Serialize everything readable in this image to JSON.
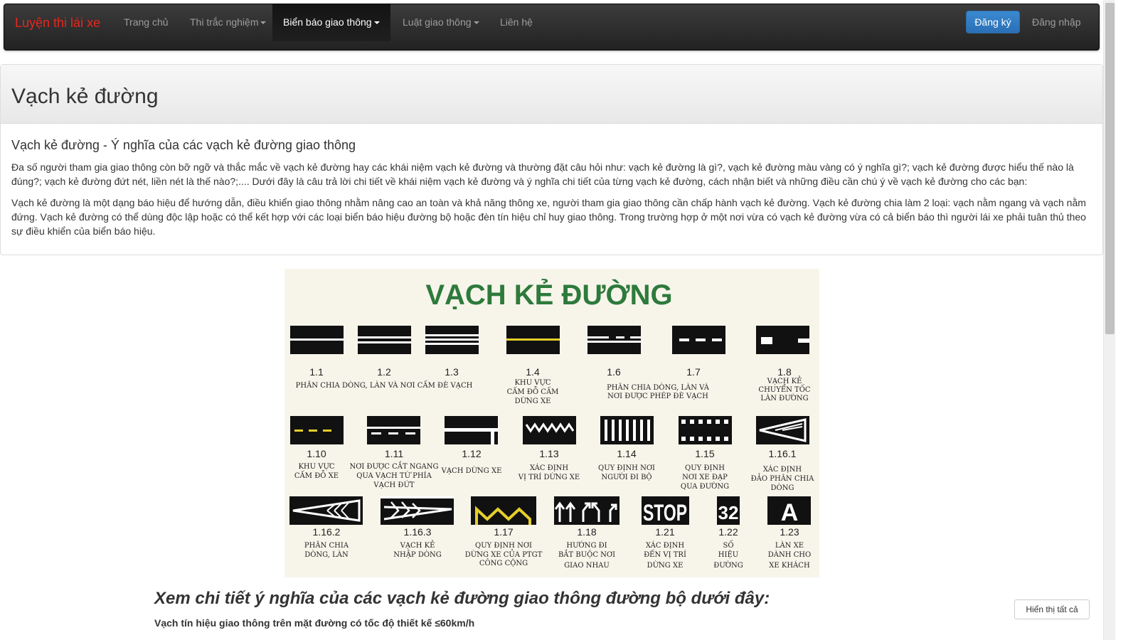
{
  "navbar": {
    "brand": "Luyện thi lái xe",
    "items": [
      {
        "label": "Trang chủ",
        "dropdown": false
      },
      {
        "label": "Thi trắc nghiệm",
        "dropdown": true
      },
      {
        "label": "Biển báo giao thông",
        "dropdown": true,
        "active": true
      },
      {
        "label": "Luật giao thông",
        "dropdown": true
      },
      {
        "label": "Liên hệ",
        "dropdown": false
      }
    ],
    "register_label": "Đăng ký",
    "login_label": "Đăng nhập"
  },
  "panel": {
    "title": "Vạch kẻ đường",
    "subtitle": "Vạch kẻ đường - Ý nghĩa của các vạch kẻ đường giao thông",
    "paragraphs": [
      "Đa số người tham gia giao thông còn bỡ ngỡ và thắc mắc về vạch kẻ đường hay các khái niệm vạch kẻ đường và thường đặt câu hỏi như: vạch kẻ đường là gì?, vạch kẻ đường màu vàng có ý nghĩa gì?; vạch kẻ đường được hiểu thế nào là đúng?; vạch kẻ đường đứt nét, liền nét là thế nào?;.... Dưới đây là câu trả lời chi tiết về khái niệm vạch kẻ đường và ý nghĩa chi tiết của từng vạch kẻ đường, cách nhận biết và những điều cần chú ý về vạch kẻ đường cho các bạn:",
      "Vạch kẻ đường là một dạng báo hiệu để hướng dẫn, điều khiển giao thông nhằm nâng cao an toàn và khả năng thông xe, người tham gia giao thông cần chấp hành vạch kẻ đường. Vạch kẻ đường chia làm 2 loại: vạch nằm ngang và vạch nằm đứng. Vạch kẻ đường có thể dùng độc lập hoặc có thể kết hợp với các loại biển báo hiệu đường bộ hoặc đèn tín hiệu chỉ huy giao thông. Trong trường hợp ở một nơi vừa có vạch kẻ đường vừa có cả biển báo thì người lái xe phải tuân thủ theo sự điều khiển của biển báo hiệu."
    ]
  },
  "sign_image": {
    "title": "VẠCH KẺ ĐƯỜNG",
    "title_color": "#2e7a3c",
    "row1_codes": [
      "1.1",
      "1.2",
      "1.3",
      "1.4",
      "1.6",
      "1.7",
      "1.8"
    ],
    "row1_captions": {
      "c123": "PHÂN CHIA DÒNG, LÀN VÀ NƠI CẤM ĐÈ VẠCH",
      "c14": [
        "KHU VỰC",
        "CẤM ĐỖ CẤM",
        "DỪNG XE"
      ],
      "c167": [
        "PHÂN CHIA DÒNG, LÀN VÀ",
        "NƠI ĐƯỢC PHÉP ĐÈ VẠCH"
      ],
      "c18": [
        "VẠCH KẺ",
        "CHUYỂN TỐC",
        "LÀN ĐƯỜNG"
      ]
    },
    "row2": [
      {
        "code": "1.10",
        "caption": [
          "KHU VỰC",
          "CẤM ĐỖ XE"
        ]
      },
      {
        "code": "1.11",
        "caption": [
          "NƠI ĐƯỢC CẮT NGANG",
          "QUA VẠCH TỪ PHÍA",
          "VẠCH ĐỨT"
        ]
      },
      {
        "code": "1.12",
        "caption": [
          "VẠCH  DỪNG XE"
        ]
      },
      {
        "code": "1.13",
        "caption": [
          "XÁC ĐỊNH",
          "VỊ TRÍ DỪNG XE"
        ]
      },
      {
        "code": "1.14",
        "caption": [
          "QUY ĐỊNH NƠI",
          "NGƯỜI ĐI BỘ"
        ]
      },
      {
        "code": "1.15",
        "caption": [
          "QUY ĐỊNH",
          "NƠI XE ĐẠP",
          "QUA ĐƯỜNG"
        ]
      },
      {
        "code": "1.16.1",
        "caption": [
          "XÁC ĐỊNH",
          "ĐẢO PHÂN CHIA",
          "DÒNG"
        ]
      }
    ],
    "row3": [
      {
        "code": "1.16.2",
        "caption": [
          "PHÂN CHIA",
          "DÒNG, LÀN"
        ]
      },
      {
        "code": "1.16.3",
        "caption": [
          "VẠCH KẺ",
          "NHẬP DÒNG"
        ]
      },
      {
        "code": "1.17",
        "caption": [
          "QUY ĐỊNH NƠI",
          "DỪNG XE CỦA PTGT",
          "CÔNG CỘNG"
        ]
      },
      {
        "code": "1.18",
        "caption": [
          "HƯỚNG ĐI",
          "BẮT BUỘC NƠI",
          "GIAO NHAU"
        ]
      },
      {
        "code": "1.21",
        "caption": [
          "XÁC ĐỊNH",
          "ĐẾN VỊ TRÍ",
          "DỪNG XE"
        ]
      },
      {
        "code": "1.22",
        "caption": [
          "SỐ",
          "HIỆU",
          "ĐƯỜNG"
        ]
      },
      {
        "code": "1.23",
        "caption": [
          "LÀN XE",
          "DÀNH CHO",
          "XE KHÁCH"
        ]
      }
    ],
    "marking_text": {
      "stop": "STOP",
      "number": "32",
      "letter": "A"
    },
    "yellow": "#e6cf2b"
  },
  "section": {
    "heading": "Xem chi tiết ý nghĩa của các vạch kẻ đường giao thông đường bộ dưới đây:",
    "subheading": "Vạch tín hiệu giao thông trên mặt đường có tốc độ thiết kế ≤60km/h"
  },
  "show_all_label": "Hiển thị tất cả"
}
